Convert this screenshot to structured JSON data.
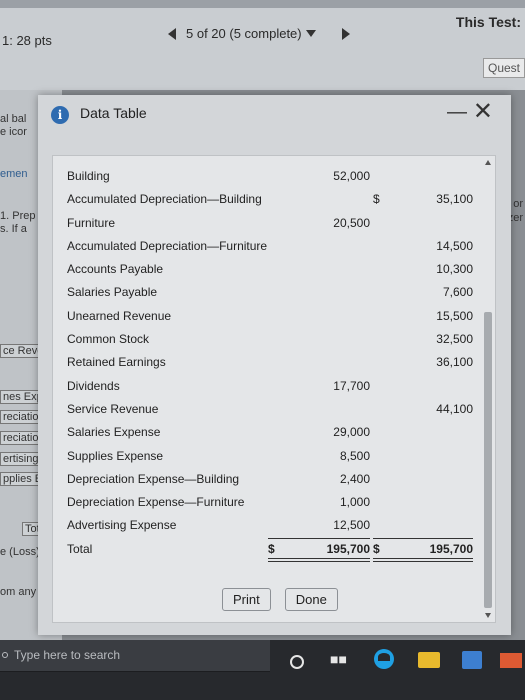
{
  "header": {
    "points": "1: 28 pts",
    "progress": "5 of 20 (5 complete)",
    "test_title": "This Test:",
    "question_tab": "Quest"
  },
  "background_fragments": {
    "left": [
      "al bal",
      "e icor",
      "emen",
      "1. Prep",
      "s. If a",
      "ce Reve",
      "nes Exp",
      "reciation",
      "reciation",
      "ertising E",
      "pplies Exp",
      "Total",
      "e (Loss)",
      "om any list"
    ],
    "right": [
      "or",
      "zer"
    ]
  },
  "modal": {
    "title": "Data Table",
    "rows": [
      {
        "account": "Building",
        "debit": "52,000",
        "credit": ""
      },
      {
        "account": "Accumulated Depreciation—Building",
        "debit": "",
        "credit": "35,100",
        "credit_sign": "$"
      },
      {
        "account": "Furniture",
        "debit": "20,500",
        "credit": ""
      },
      {
        "account": "Accumulated Depreciation—Furniture",
        "debit": "",
        "credit": "14,500"
      },
      {
        "account": "Accounts Payable",
        "debit": "",
        "credit": "10,300"
      },
      {
        "account": "Salaries Payable",
        "debit": "",
        "credit": "7,600"
      },
      {
        "account": "Unearned Revenue",
        "debit": "",
        "credit": "15,500"
      },
      {
        "account": "Common Stock",
        "debit": "",
        "credit": "32,500"
      },
      {
        "account": "Retained Earnings",
        "debit": "",
        "credit": "36,100"
      },
      {
        "account": "Dividends",
        "debit": "17,700",
        "credit": ""
      },
      {
        "account": "Service Revenue",
        "debit": "",
        "credit": "44,100"
      },
      {
        "account": "Salaries Expense",
        "debit": "29,000",
        "credit": ""
      },
      {
        "account": "Supplies Expense",
        "debit": "8,500",
        "credit": ""
      },
      {
        "account": "Depreciation Expense—Building",
        "debit": "2,400",
        "credit": ""
      },
      {
        "account": "Depreciation Expense—Furniture",
        "debit": "1,000",
        "credit": ""
      },
      {
        "account": "Advertising Expense",
        "debit": "12,500",
        "credit": ""
      },
      {
        "account": "Total",
        "debit": "195,700",
        "credit": "195,700",
        "debit_sign": "$",
        "credit_sign": "$"
      }
    ]
  },
  "buttons": {
    "print": "Print",
    "done": "Done"
  },
  "taskbar": {
    "search_placeholder": "Type here to search",
    "taskview_glyph": "■■"
  }
}
